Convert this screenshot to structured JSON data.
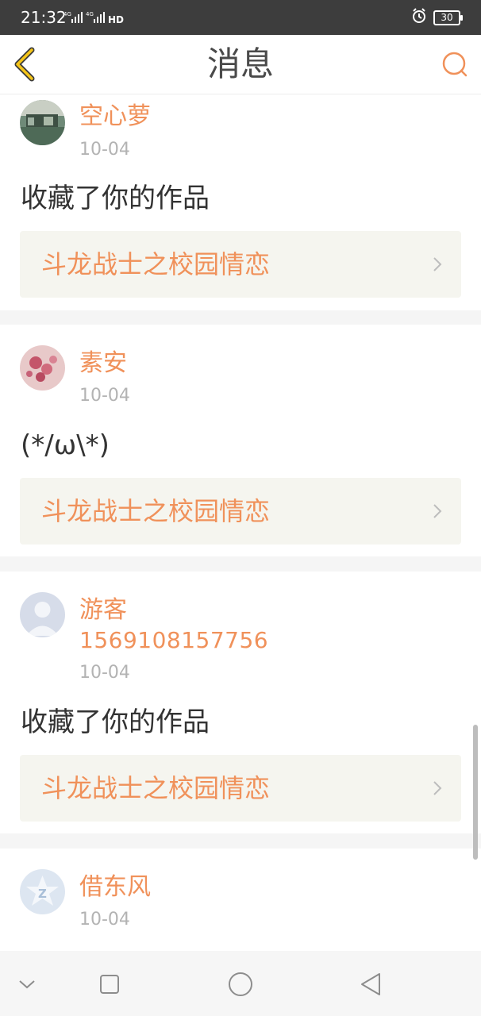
{
  "status_bar": {
    "time": "21:32",
    "signal_text": "4G ıl 4G ıl HD",
    "battery": "30",
    "icons": [
      "signal-icon",
      "alarm-icon",
      "battery-icon"
    ]
  },
  "header": {
    "title": "消息",
    "back_icon": "chevron-left-icon",
    "search_icon": "search-icon",
    "accent_color": "#f0915a"
  },
  "messages": [
    {
      "username": "空心萝",
      "user_id": "",
      "date": "10-04",
      "text": "收藏了你的作品",
      "work_title": "斗龙战士之校园情恋",
      "avatar_icon": "avatar-photo"
    },
    {
      "username": "素安",
      "user_id": "",
      "date": "10-04",
      "text": "(*/ω\\*)",
      "work_title": "斗龙战士之校园情恋",
      "avatar_icon": "avatar-photo"
    },
    {
      "username": "游客",
      "user_id": "1569108157756",
      "date": "10-04",
      "text": "收藏了你的作品",
      "work_title": "斗龙战士之校园情恋",
      "avatar_icon": "default-avatar-icon"
    },
    {
      "username": "借东风",
      "user_id": "",
      "date": "10-04",
      "text": "",
      "work_title": "",
      "avatar_icon": "qzone-avatar-icon"
    }
  ],
  "nav_bar": {
    "icons": [
      "chevron-down-icon",
      "recents-icon",
      "home-icon",
      "back-triangle-icon"
    ]
  }
}
